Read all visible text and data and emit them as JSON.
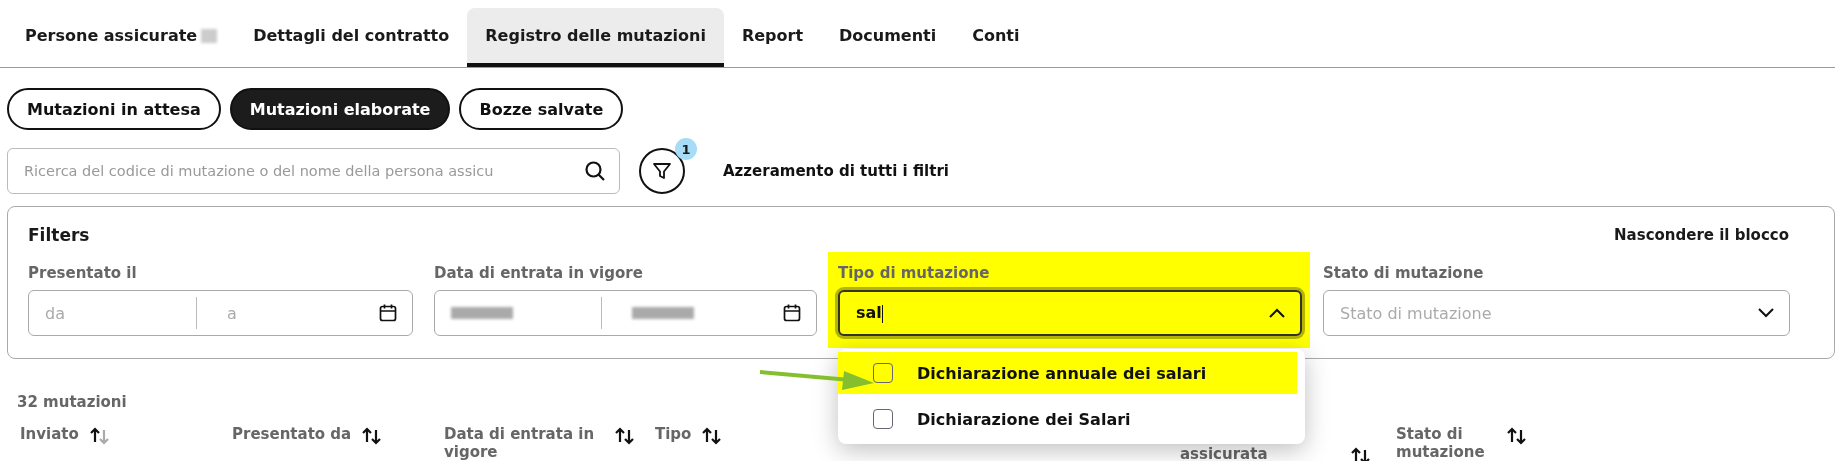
{
  "tabs": [
    {
      "label": "Persone assicurate",
      "selected": false,
      "masked": true
    },
    {
      "label": "Dettagli del contratto",
      "selected": false,
      "masked": false
    },
    {
      "label": "Registro delle mutazioni",
      "selected": true,
      "masked": false
    },
    {
      "label": "Report",
      "selected": false,
      "masked": false
    },
    {
      "label": "Documenti",
      "selected": false,
      "masked": false
    },
    {
      "label": "Conti",
      "selected": false,
      "masked": false
    }
  ],
  "segments": [
    {
      "label": "Mutazioni in attesa",
      "selected": false
    },
    {
      "label": "Mutazioni elaborate",
      "selected": true
    },
    {
      "label": "Bozze salvate",
      "selected": false
    }
  ],
  "search": {
    "placeholder": "Ricerca del codice di mutazione o del nome della persona assicu"
  },
  "filter_button": {
    "badge": "1"
  },
  "reset_link": "Azzeramento di tutti i filtri",
  "filters": {
    "title": "Filters",
    "hide_link": "Nascondere il blocco",
    "fields": [
      {
        "kind": "date_range",
        "label": "Presentato il",
        "from": {
          "placeholder": "da",
          "masked": false
        },
        "to": {
          "placeholder": "a",
          "masked": false
        },
        "highlighted": false
      },
      {
        "kind": "date_range",
        "label": "Data di entrata in vigore",
        "from": {
          "masked": true
        },
        "to": {
          "masked": true
        },
        "highlighted": false
      },
      {
        "kind": "combobox",
        "label": "Tipo di mutazione",
        "value": "sal",
        "expanded": true,
        "highlighted": true
      },
      {
        "kind": "select",
        "label": "Stato di mutazione",
        "placeholder": "Stato di mutazione",
        "expanded": false,
        "highlighted": false
      }
    ]
  },
  "dropdown": {
    "options": [
      {
        "label": "Dichiarazione annuale dei salari",
        "checked": false,
        "highlighted": true
      },
      {
        "label": "Dichiarazione dei Salari",
        "checked": false,
        "highlighted": false
      }
    ]
  },
  "result_count": "32 mutazioni",
  "table": {
    "columns": [
      {
        "label": "Inviato",
        "sorted": true
      },
      {
        "label": "Presentato da",
        "sorted": false
      },
      {
        "label": "Data di entrata in vigore",
        "sorted": false
      },
      {
        "label": "Tipo",
        "sorted": false
      },
      {
        "label": "assicurata",
        "sorted": false
      },
      {
        "label": "Stato di mutazione",
        "sorted": false
      }
    ]
  }
}
